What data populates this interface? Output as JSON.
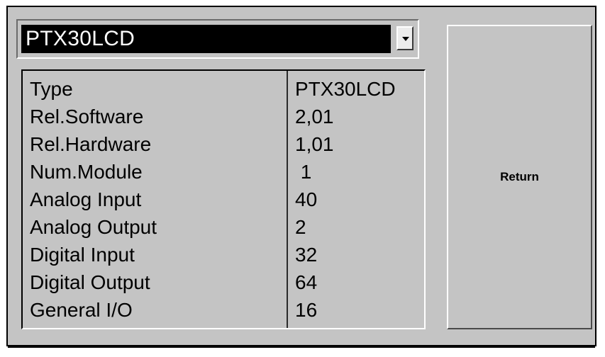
{
  "selector": {
    "value": "PTX30LCD"
  },
  "info": {
    "rows": [
      {
        "label": "Type",
        "value": "PTX30LCD"
      },
      {
        "label": "Rel.Software",
        "value": "2,01"
      },
      {
        "label": "Rel.Hardware",
        "value": "1,01"
      },
      {
        "label": "Num.Module",
        "value": " 1"
      },
      {
        "label": "Analog Input",
        "value": "40"
      },
      {
        "label": "Analog Output",
        "value": "2"
      },
      {
        "label": "Digital Input",
        "value": "32"
      },
      {
        "label": "Digital Output",
        "value": "64"
      },
      {
        "label": "General I/O",
        "value": "16"
      }
    ]
  },
  "buttons": {
    "return_label": "Return"
  },
  "colors": {
    "panel": "#c4c4c4",
    "selected_bg": "#000000",
    "selected_text": "#ffffff"
  }
}
